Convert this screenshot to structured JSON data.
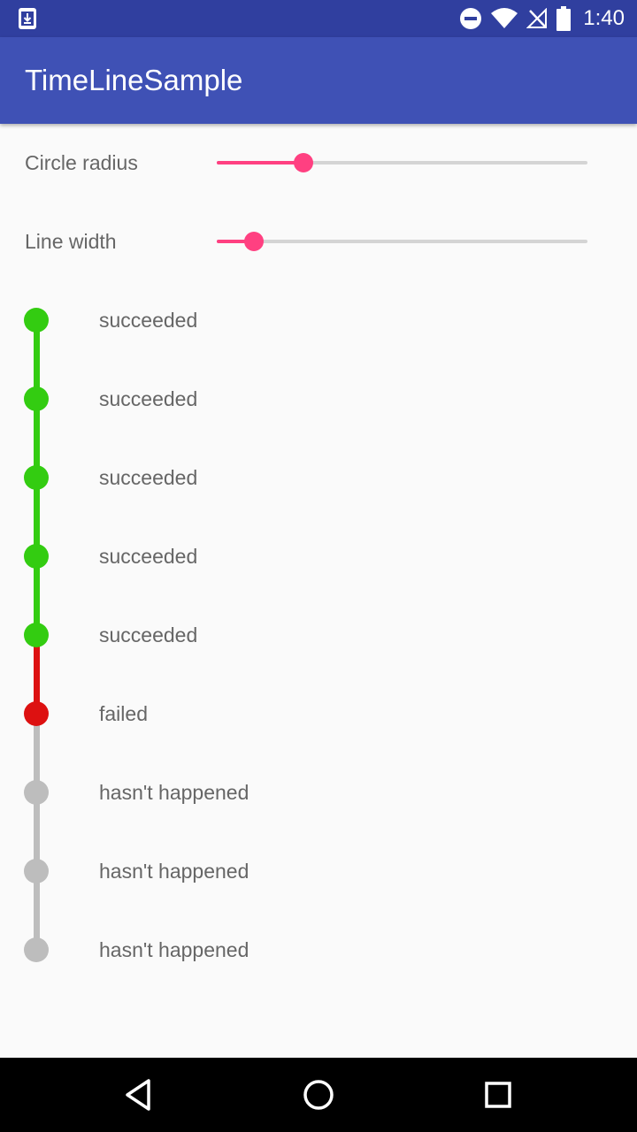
{
  "status_bar": {
    "time": "1:40",
    "icons": [
      "download-notification-icon",
      "do-not-disturb-icon",
      "wifi-icon",
      "no-signal-icon",
      "battery-icon"
    ]
  },
  "app_bar": {
    "title": "TimeLineSample"
  },
  "controls": {
    "circle_radius": {
      "label": "Circle radius",
      "value_fraction": 0.233
    },
    "line_width": {
      "label": "Line width",
      "value_fraction": 0.1
    }
  },
  "timeline": {
    "colors": {
      "succeeded": "#33cc11",
      "failed": "#dd1111",
      "pending": "#bdbdbd"
    },
    "items": [
      {
        "label": "succeeded",
        "status": "succeeded"
      },
      {
        "label": "succeeded",
        "status": "succeeded"
      },
      {
        "label": "succeeded",
        "status": "succeeded"
      },
      {
        "label": "succeeded",
        "status": "succeeded"
      },
      {
        "label": "succeeded",
        "status": "succeeded"
      },
      {
        "label": "failed",
        "status": "failed"
      },
      {
        "label": "hasn't happened",
        "status": "pending"
      },
      {
        "label": "hasn't happened",
        "status": "pending"
      },
      {
        "label": "hasn't happened",
        "status": "pending"
      }
    ]
  },
  "theme": {
    "primary": "#3f51b5",
    "primary_dark": "#303f9f",
    "accent": "#ff4081"
  },
  "nav_bar": {
    "buttons": [
      "back-icon",
      "home-icon",
      "recents-icon"
    ]
  }
}
